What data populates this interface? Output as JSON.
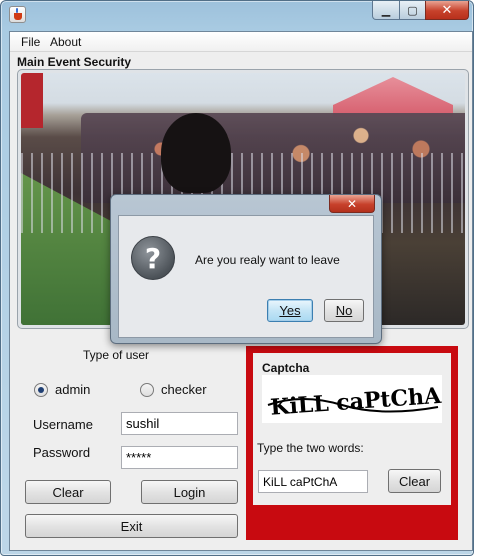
{
  "menu": {
    "file": "File",
    "about": "About"
  },
  "section_title": "Main Event Security",
  "dialog": {
    "message": "Are you realy want to leave",
    "close_glyph": "✕",
    "icon_glyph": "?",
    "yes_label": "Yes",
    "no_label": "No"
  },
  "login": {
    "type_label": "Type of user",
    "role_admin": "admin",
    "role_checker": "checker",
    "selected_role": "admin",
    "username_label": "Username",
    "username_value": "sushil",
    "password_label": "Password",
    "password_value": "*****",
    "clear_label": "Clear",
    "login_label": "Login",
    "exit_label": "Exit"
  },
  "captcha": {
    "title": "Captcha",
    "image_text": "KiLL caPtChA",
    "prompt": "Type the two words:",
    "input_value": "KiLL caPtChA",
    "clear_label": "Clear"
  },
  "colors": {
    "captcha_border": "#c80a10",
    "window_frame": "#a9cbe2",
    "close_button": "#c7412b"
  },
  "icons": {
    "app": "java-cup-icon",
    "dialog": "question-icon",
    "minimize": "minimize-icon",
    "maximize": "maximize-icon",
    "close": "close-icon"
  }
}
